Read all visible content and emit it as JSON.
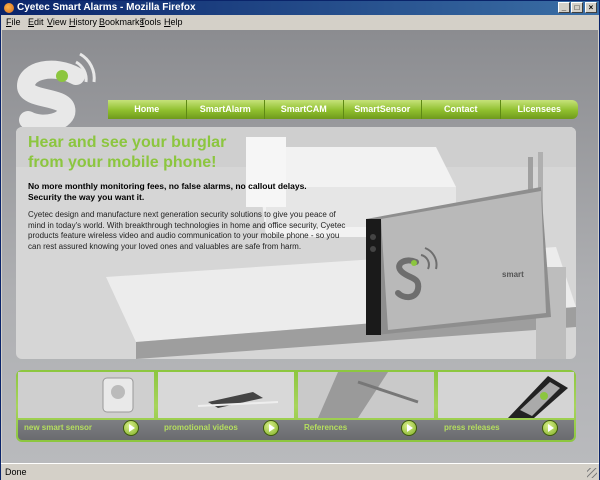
{
  "window": {
    "title": "Cyetec Smart Alarms - Mozilla Firefox"
  },
  "menu": [
    "File",
    "Edit",
    "View",
    "History",
    "Bookmarks",
    "Tools",
    "Help"
  ],
  "nav": [
    "Home",
    "SmartAlarm",
    "SmartCAM",
    "SmartSensor",
    "Contact",
    "Licensees"
  ],
  "hero": {
    "headline_line1": "Hear and see your burglar",
    "headline_line2": "from your mobile phone!",
    "subhead_line1": "No more monthly monitoring fees, no false alarms, no callout delays.",
    "subhead_line2": "Security the way you want it.",
    "body": "Cyetec design and manufacture next generation security solutions to give you peace of mind in today's world. With breakthrough technologies in home and office security, Cyetec products feature wireless video and audio communication to your mobile phone - so you can rest assured knowing your loved ones and valuables are safe from harm.",
    "device_label": "smart"
  },
  "tiles": [
    "new smart sensor",
    "promotional videos",
    "References",
    "press releases"
  ],
  "status": "Done",
  "colors": {
    "accent_green": "#8cc63f",
    "title_bar": "#0a246a"
  }
}
